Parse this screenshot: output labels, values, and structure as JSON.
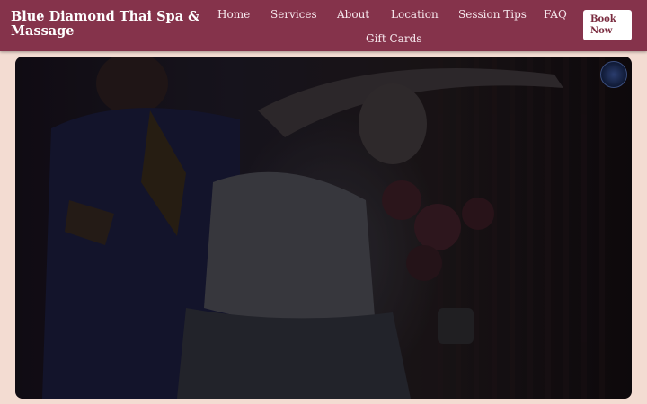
{
  "header": {
    "brand": "Blue Diamond Thai Spa & Massage",
    "nav": {
      "home": "Home",
      "services": "Services",
      "about": "About",
      "location": "Location",
      "session_tips": "Session Tips",
      "faq": "FAQ",
      "gift_cards": "Gift Cards"
    },
    "book_now": "Book Now"
  },
  "hero": {
    "image_subject": "therapist-stretching-client-photo",
    "logo_icon": "blue-diamond-logo-icon"
  },
  "colors": {
    "header_bg": "#85334b",
    "page_bg": "#f3dcd2",
    "button_bg": "#ffffff",
    "button_text": "#7a2b3f"
  }
}
